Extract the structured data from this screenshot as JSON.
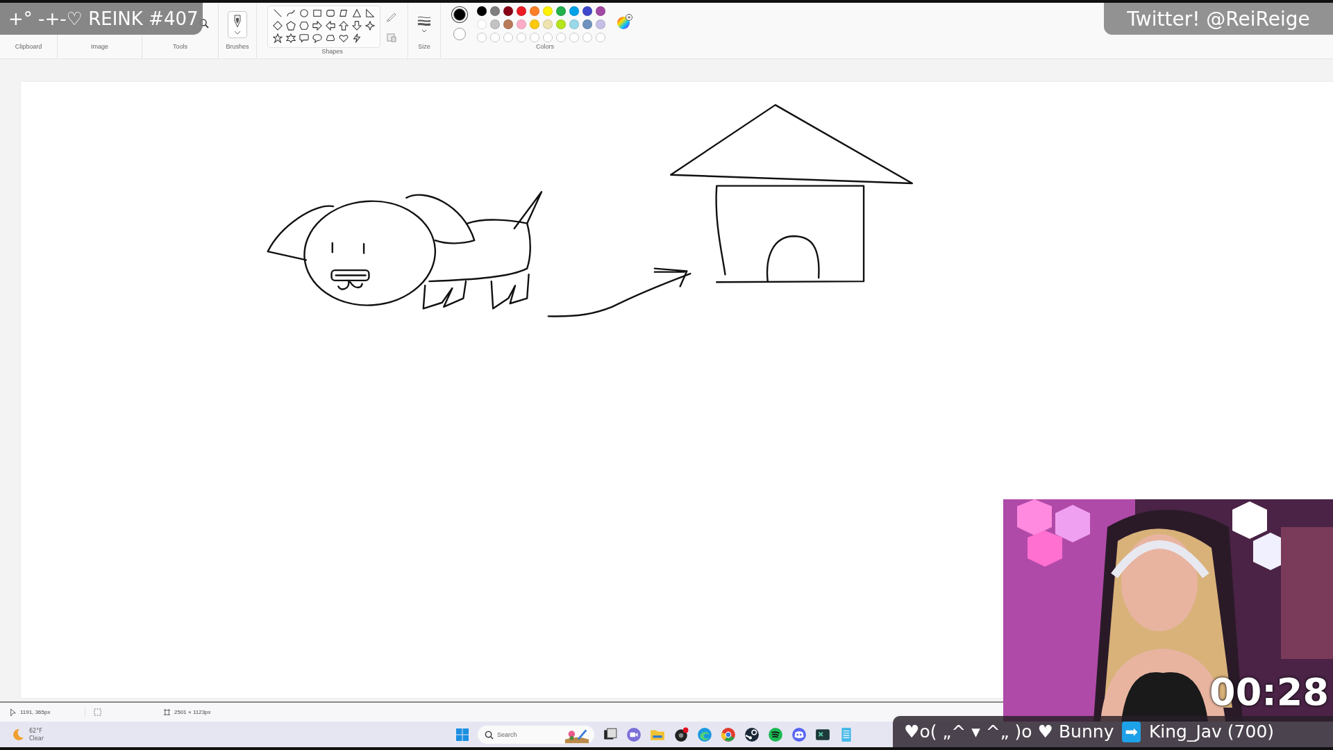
{
  "stream_overlay": {
    "title": "+° -+-♡ REINK #407",
    "social": "Twitter! @ReiReige"
  },
  "ribbon": {
    "groups": [
      {
        "label": "Clipboard"
      },
      {
        "label": "Image"
      },
      {
        "label": "Tools"
      },
      {
        "label": "Brushes"
      },
      {
        "label": "Shapes"
      },
      {
        "label": "Size"
      },
      {
        "label": "Colors"
      }
    ],
    "primary_color": {
      "color": "#000000",
      "selected": true
    },
    "secondary_color": {
      "color": "#ffffff",
      "selected": false
    },
    "palette": [
      {
        "kind": "swatch",
        "color": "#000000"
      },
      {
        "kind": "swatch",
        "color": "#7f7f7f"
      },
      {
        "kind": "swatch",
        "color": "#880015"
      },
      {
        "kind": "swatch",
        "color": "#ed1c24"
      },
      {
        "kind": "swatch",
        "color": "#ff7f27"
      },
      {
        "kind": "swatch",
        "color": "#fff200"
      },
      {
        "kind": "swatch",
        "color": "#22b14c"
      },
      {
        "kind": "swatch",
        "color": "#00a2e8"
      },
      {
        "kind": "swatch",
        "color": "#3f48cc"
      },
      {
        "kind": "swatch",
        "color": "#a349a4"
      },
      {
        "kind": "swatch",
        "color": "#ffffff"
      },
      {
        "kind": "swatch",
        "color": "#c3c3c3"
      },
      {
        "kind": "swatch",
        "color": "#b97a57"
      },
      {
        "kind": "swatch",
        "color": "#ffaec9"
      },
      {
        "kind": "swatch",
        "color": "#ffc90e"
      },
      {
        "kind": "swatch",
        "color": "#efe4b0"
      },
      {
        "kind": "swatch",
        "color": "#b5e61d"
      },
      {
        "kind": "swatch",
        "color": "#99d9ea"
      },
      {
        "kind": "swatch",
        "color": "#7092be"
      },
      {
        "kind": "swatch",
        "color": "#c8bfe7"
      },
      {
        "kind": "empty"
      },
      {
        "kind": "empty"
      },
      {
        "kind": "empty"
      },
      {
        "kind": "empty"
      },
      {
        "kind": "empty"
      },
      {
        "kind": "empty"
      },
      {
        "kind": "empty"
      },
      {
        "kind": "empty"
      },
      {
        "kind": "empty"
      },
      {
        "kind": "empty"
      }
    ]
  },
  "status_bar": {
    "cursor_position": "1191, 365px",
    "canvas_size": "2501 × 1123px"
  },
  "taskbar": {
    "weather": {
      "temperature": "62°F",
      "condition": "Clear"
    },
    "search": {
      "placeholder": "Search"
    }
  },
  "webcam": {
    "kind": "picture",
    "timer": "00:28"
  },
  "alert": {
    "donor": "♥o( „^ ▾ ^„ )o ♥ Bunny",
    "arrow": "➡",
    "recipient": "King_Jav (700)"
  }
}
